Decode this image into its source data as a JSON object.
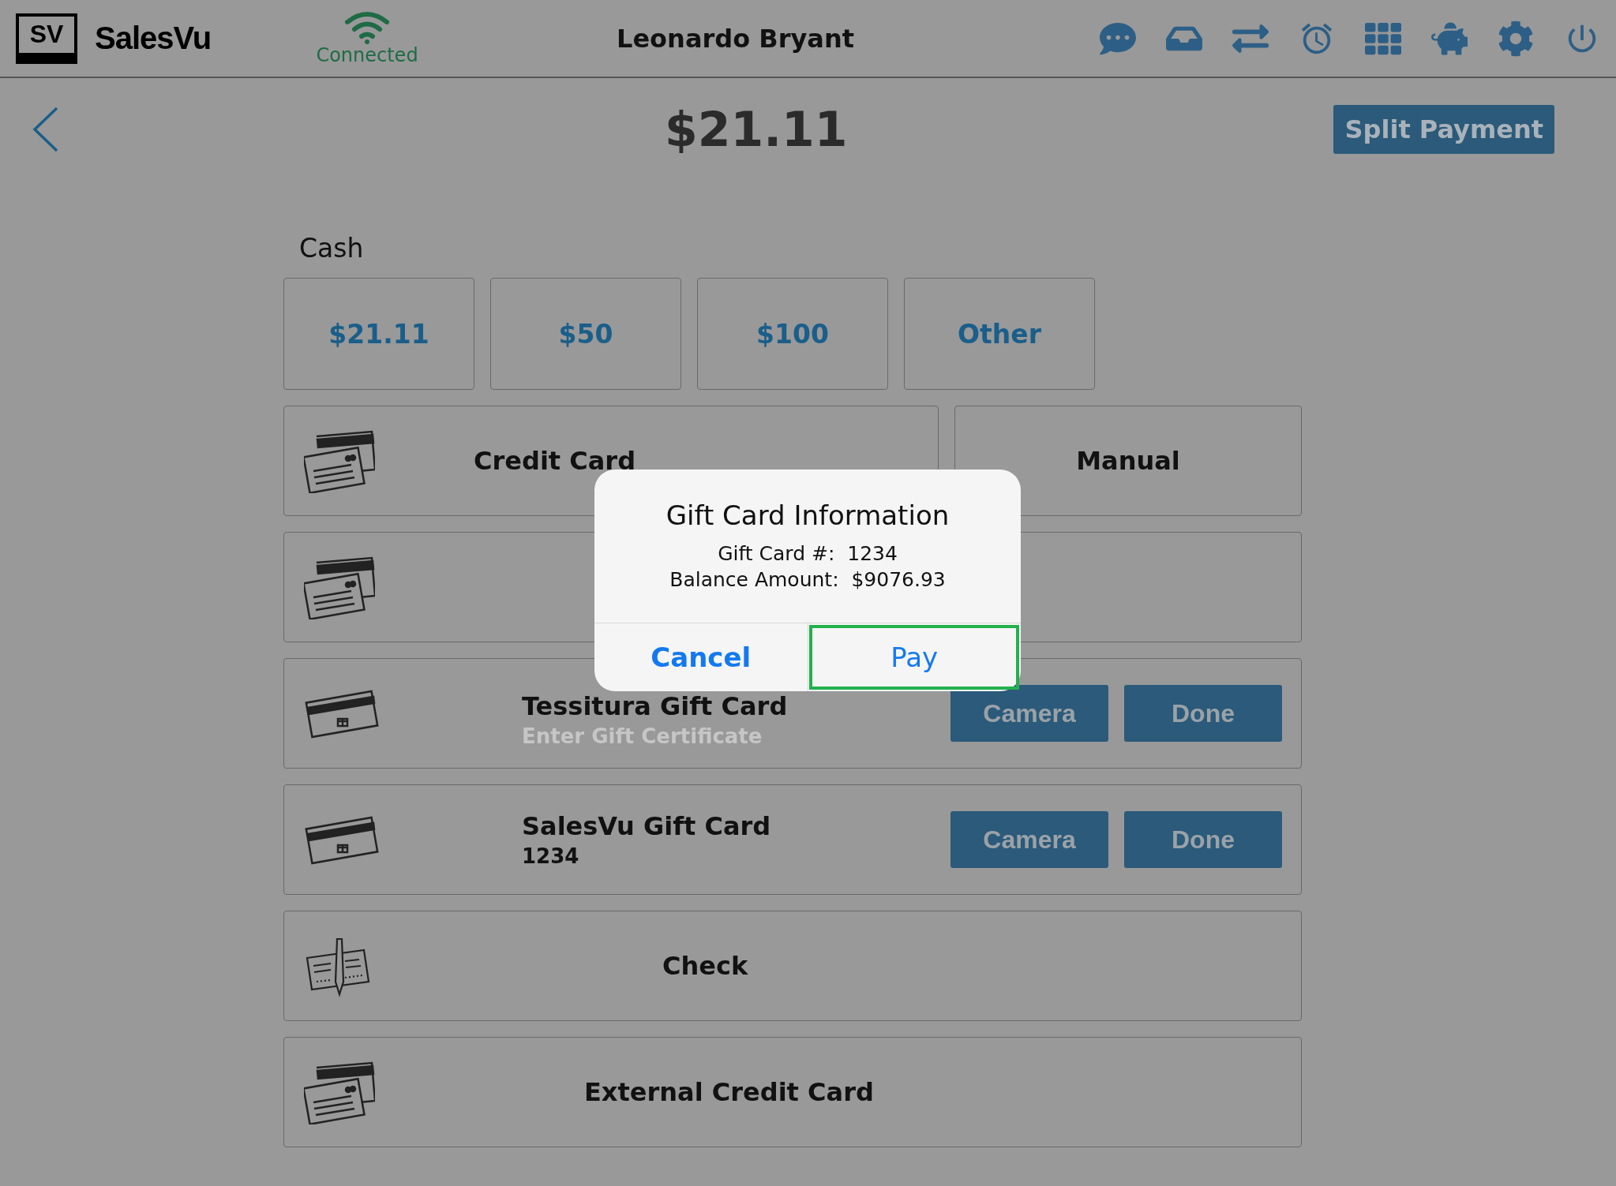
{
  "header": {
    "logo": {
      "badge": "SV",
      "name": "SalesVu"
    },
    "connection": "Connected",
    "user": "Leonardo Bryant"
  },
  "amount": "$21.11",
  "split_button": "Split Payment",
  "cash": {
    "label": "Cash",
    "options": [
      "$21.11",
      "$50",
      "$100",
      "Other"
    ]
  },
  "methods": [
    {
      "kind": "card",
      "label": "Credit Card",
      "side_label": "Manual"
    },
    {
      "kind": "card",
      "side": true
    },
    {
      "kind": "gift",
      "label": "Tessitura Gift Card",
      "placeholder": "Enter Gift Certificate",
      "buttons": [
        "Camera",
        "Done"
      ]
    },
    {
      "kind": "gift",
      "label": "SalesVu Gift Card",
      "value": "1234",
      "buttons": [
        "Camera",
        "Done"
      ]
    },
    {
      "kind": "check",
      "label": "Check"
    },
    {
      "kind": "card",
      "label": "External Credit Card"
    }
  ],
  "dialog": {
    "title": "Gift Card Information",
    "lines": [
      "Gift Card #:  1234",
      "Balance Amount:  $9076.93"
    ],
    "buttons": [
      {
        "label": "Cancel",
        "selected": false
      },
      {
        "label": "Pay",
        "selected": true
      }
    ]
  }
}
